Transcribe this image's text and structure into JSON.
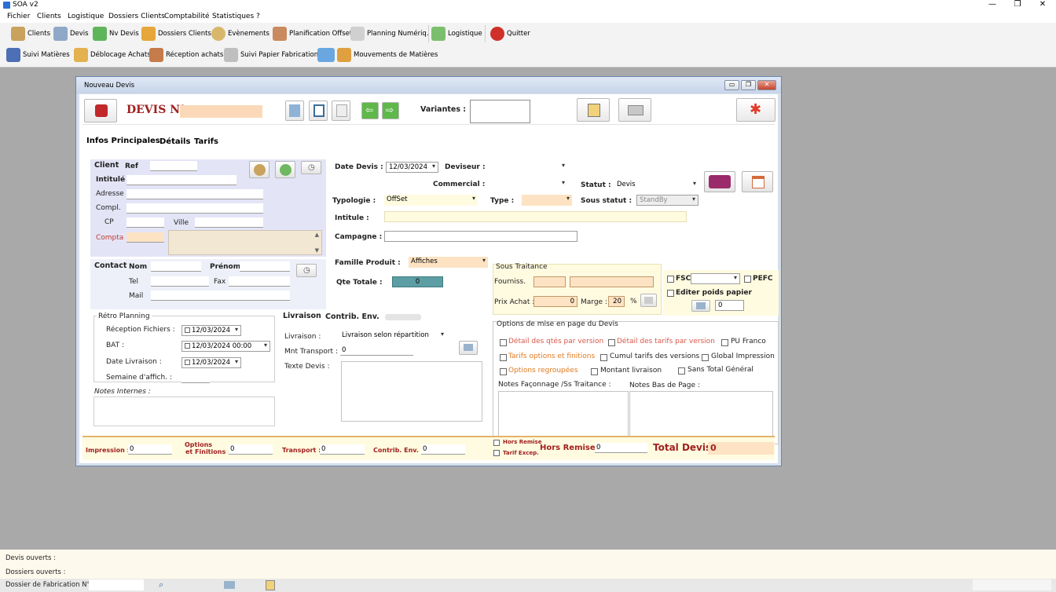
{
  "app": {
    "title": "SOA v2"
  },
  "menu": [
    "Fichier",
    "Clients",
    "Logistique",
    "Dossiers Clients",
    "Comptabilité",
    "Statistiques",
    "?"
  ],
  "toolbar_row1": [
    "Clients",
    "Devis",
    "Nv Devis",
    "Dossiers Clients",
    "Evènements",
    "Planification Offset",
    "Planning Numériq.",
    "Logistique",
    "Quitter"
  ],
  "toolbar_row2": [
    "Suivi Matières",
    "Déblocage Achats",
    "Réception achats",
    "Suivi Papier Fabrication",
    "Mouvements de Matières"
  ],
  "window": {
    "title": "Nouveau Devis",
    "devis_label": "DEVIS N°",
    "devis_number": "",
    "variantes_label": "Variantes :",
    "variantes_value": ""
  },
  "tabs": [
    "Infos Principales",
    "Détails",
    "Tarifs"
  ],
  "client": {
    "title": "Client",
    "ref_label": "Ref",
    "ref": "",
    "intitule_label": "Intitulé",
    "adresse_label": "Adresse",
    "compl_label": "Compl.",
    "cp_label": "CP",
    "ville_label": "Ville",
    "compta_label": "Compta"
  },
  "contact": {
    "title": "Contact",
    "nom_label": "Nom",
    "prenom_label": "Prénom",
    "tel_label": "Tel",
    "fax_label": "Fax",
    "mail_label": "Mail"
  },
  "retro": {
    "title": "Rétro Planning",
    "reception_label": "Réception Fichiers :",
    "reception_value": "12/03/2024",
    "bat_label": "BAT :",
    "bat_value": "12/03/2024 00:00",
    "livraison_label": "Date Livraison :",
    "livraison_value": "12/03/2024",
    "semaine_label": "Semaine d'affich. :"
  },
  "notes_internes_label": "Notes Internes :",
  "main": {
    "date_label": "Date Devis :",
    "date_value": "12/03/2024",
    "deviseur_label": "Deviseur :",
    "commercial_label": "Commercial :",
    "statut_label": "Statut :",
    "statut_value": "Devis",
    "typologie_label": "Typologie :",
    "typologie_value": "OffSet",
    "type_label": "Type :",
    "sous_statut_label": "Sous statut :",
    "sous_statut_value": "StandBy",
    "intitule_label": "Intitule :",
    "campagne_label": "Campagne :",
    "famille_label": "Famille Produit :",
    "famille_value": "Affiches",
    "qte_label": "Qte Totale :",
    "qte_value": "0"
  },
  "sous_traitance": {
    "title": "Sous Traitance",
    "fourniss_label": "Fourniss.",
    "prix_label": "Prix Achat :",
    "prix_value": "0",
    "marge_label": "Marge :",
    "marge_value": "20",
    "pct": "%"
  },
  "fsc": {
    "fsc_label": "FSC",
    "pefc_label": "PEFC",
    "editer_label": "Editer poids papier",
    "poids_value": "0"
  },
  "livraison": {
    "tab1": "Livraison",
    "tab2": "Contrib. Env.",
    "livraison_label": "Livraison :",
    "livraison_value": "Livraison selon répartition",
    "mnt_label": "Mnt Transport :",
    "mnt_value": "0",
    "texte_label": "Texte Devis :"
  },
  "options": {
    "title": "Options de mise en page du Devis",
    "items": [
      "Détail des qtés par version",
      "Détail des tarifs par version",
      "PU Franco",
      "Tarifs options et finitions",
      "Cumul tarifs des versions",
      "Global Impression",
      "Options regroupées",
      "Montant livraison",
      "Sans Total Général"
    ],
    "notes_faconnage": "Notes Façonnage /Ss Traitance :",
    "notes_bas": "Notes Bas de Page :"
  },
  "totals": {
    "impression_label": "Impression :",
    "impression_value": "0",
    "options_label1": "Options",
    "options_label2": "et Finitions :",
    "options_value": "0",
    "transport_label": "Transport :",
    "transport_value": "0",
    "contrib_label": "Contrib. Env. :",
    "contrib_value": "0",
    "hors_remise_chk": "Hors Remise",
    "tarif_excep_chk": "Tarif Excep.",
    "hors_remise_label": "Hors Remise",
    "hors_remise_value": "0",
    "total_label": "Total Devis",
    "total_value": "0"
  },
  "status": {
    "devis_ouverts": "Devis ouverts :",
    "dossiers_ouverts": "Dossiers ouverts :",
    "dossier_fab": "Dossier de Fabrication N° :"
  }
}
